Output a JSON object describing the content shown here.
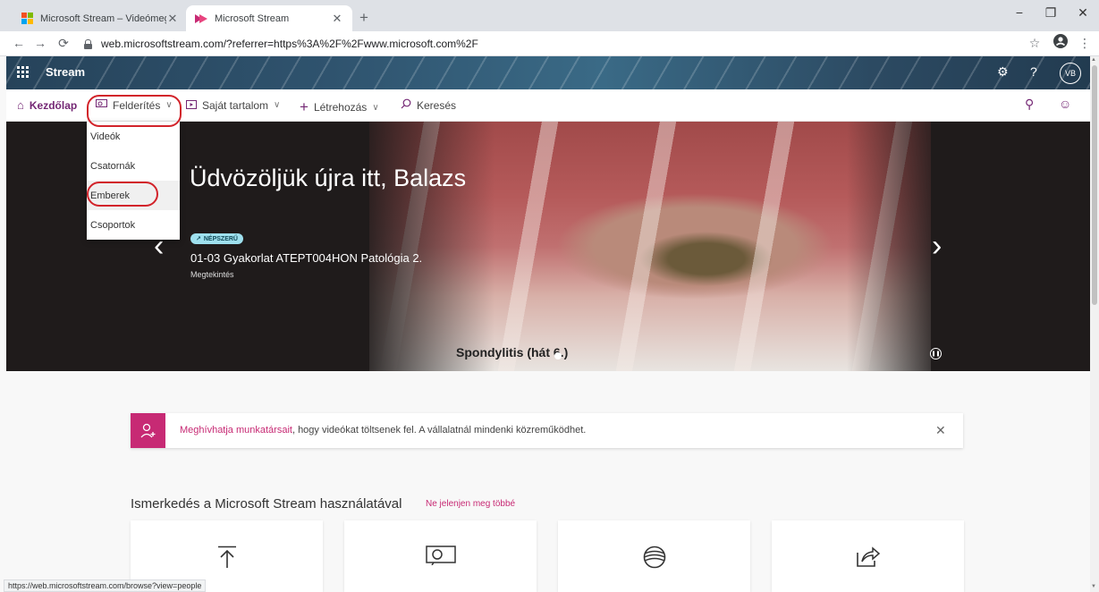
{
  "browser": {
    "tabs": [
      {
        "title": "Microsoft Stream – Videómegos",
        "active": false
      },
      {
        "title": "Microsoft Stream",
        "active": true
      }
    ],
    "new_tab_symbol": "+",
    "url": "web.microsoftstream.com/?referrer=https%3A%2F%2Fwww.microsoft.com%2F",
    "status_url": "https://web.microsoftstream.com/browse?view=people",
    "window_controls": {
      "minimize": "−",
      "restore": "❐",
      "close": "✕"
    }
  },
  "banner": {
    "brand": "Stream",
    "avatar_initials": "VB",
    "help_symbol": "?"
  },
  "nav": {
    "home": "Kezdőlap",
    "discover": "Felderítés",
    "my_content": "Saját tartalom",
    "create": "Létrehozás",
    "search": "Keresés"
  },
  "discover_menu": {
    "items": [
      "Videók",
      "Csatornák",
      "Emberek",
      "Csoportok"
    ],
    "highlighted": "Emberek"
  },
  "hero": {
    "welcome": "Üdvözöljük újra itt, Balazs",
    "badge": "NÉPSZERŰ",
    "video_title": "01-03 Gyakorlat ATEPT004HON Patológia 2.",
    "video_subtitle": "Megtekintés",
    "caption": "Spondylitis (hát 6.)"
  },
  "notice": {
    "link_text": "Meghívhatja munkatársait",
    "text": ", hogy videókat töltsenek fel. A vállalatnál mindenki közreműködhet."
  },
  "getting_started": {
    "title": "Ismerkedés a Microsoft Stream használatával",
    "dismiss": "Ne jelenjen meg többé",
    "cards": [
      "upload-icon",
      "screen-record-icon",
      "live-event-icon",
      "share-icon"
    ]
  },
  "colors": {
    "accent": "#742774",
    "invite_pink": "#c72a74",
    "annotation_red": "#d2232a",
    "badge_cyan": "#9ee0ee"
  }
}
